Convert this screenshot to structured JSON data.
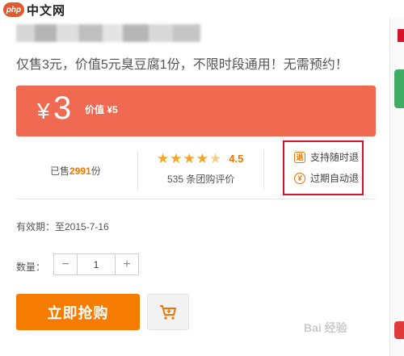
{
  "watermark": {
    "logo_text": "php",
    "site": "中文网"
  },
  "deal": {
    "subtitle": "仅售3元，价值5元臭豆腐1份，不限时段通用！无需预约！",
    "currency": "¥",
    "price": "3",
    "original_price": "价值 ¥5",
    "accent_color": "#ef6a50"
  },
  "stats": {
    "sold_prefix": "已售",
    "sold_count": "2991",
    "sold_suffix": "份",
    "rating": 4.5,
    "rating_text": "4.5",
    "reviews": "535 条团购评价"
  },
  "guarantees": [
    {
      "icon": "refund-icon",
      "glyph": "退",
      "label": "支持随时退"
    },
    {
      "icon": "auto-refund-icon",
      "glyph": "¥",
      "label": "过期自动退"
    }
  ],
  "validity": "有效期：至2015-7-16",
  "quantity": {
    "label": "数量：",
    "value": "1",
    "minus": "−",
    "plus": "+"
  },
  "actions": {
    "buy_label": "立即抢购",
    "cart_icon": "cart-icon",
    "buy_color": "#f57c00"
  },
  "bottom_watermark": "Bai 经验"
}
